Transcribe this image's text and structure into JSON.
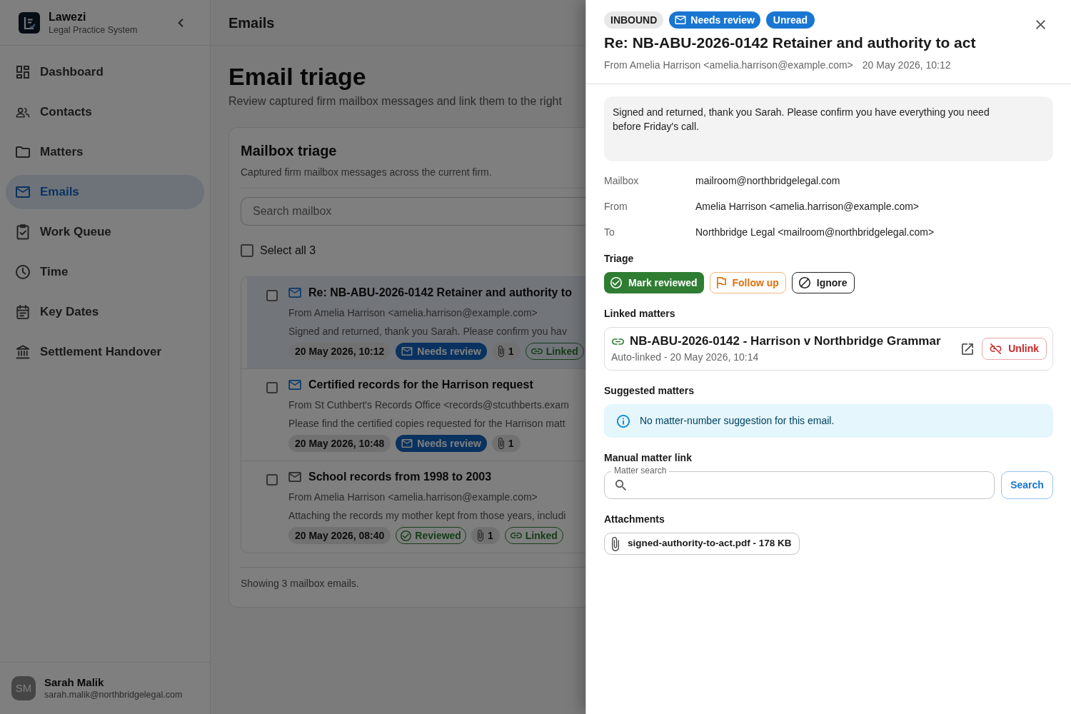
{
  "app": {
    "name": "Lawezi",
    "tagline": "Legal Practice System"
  },
  "sidebar": {
    "items": [
      {
        "label": "Dashboard",
        "selected": false
      },
      {
        "label": "Contacts",
        "selected": false
      },
      {
        "label": "Matters",
        "selected": false
      },
      {
        "label": "Emails",
        "selected": true
      },
      {
        "label": "Work Queue",
        "selected": false
      },
      {
        "label": "Time",
        "selected": false
      },
      {
        "label": "Key Dates",
        "selected": false
      },
      {
        "label": "Settlement Handover",
        "selected": false
      }
    ]
  },
  "user": {
    "initials": "SM",
    "name": "Sarah Malik",
    "email": "sarah.malik@northbridgelegal.com"
  },
  "header": {
    "title": "Emails"
  },
  "page": {
    "title": "Email triage",
    "subtitle": "Review captured firm mailbox messages and link them to the right"
  },
  "mailbox": {
    "title": "Mailbox triage",
    "subtitle": "Captured firm mailbox messages across the current firm.",
    "search": {
      "placeholder": "Search mailbox"
    },
    "select_all": {
      "label": "Select all 3",
      "checked": false
    },
    "emails": [
      {
        "subject": "Re: NB-ABU-2026-0142 Retainer and authority to",
        "from": "From Amelia Harrison <amelia.harrison@example.com>",
        "preview": "Signed and returned, thank you Sarah. Please confirm you hav",
        "date": "20 May 2026, 10:12",
        "status": {
          "kind": "needs_review",
          "label": "Needs review"
        },
        "attachments": "1",
        "link_label": "Linked",
        "unread": true,
        "selected": true,
        "checked": false
      },
      {
        "subject": "Certified records for the Harrison request",
        "from": "From St Cuthbert's Records Office <records@stcuthberts.exam",
        "preview": "Please find the certified copies requested for the Harrison matt",
        "date": "20 May 2026, 10:48",
        "status": {
          "kind": "needs_review",
          "label": "Needs review"
        },
        "attachments": "1",
        "unread": true,
        "selected": false,
        "checked": false
      },
      {
        "subject": "School records from 1998 to 2003",
        "from": "From Amelia Harrison <amelia.harrison@example.com>",
        "preview": "Attaching the records my mother kept from those years, includi",
        "date": "20 May 2026, 08:40",
        "status": {
          "kind": "reviewed",
          "label": "Reviewed"
        },
        "attachments": "1",
        "link_label": "Linked",
        "unread": false,
        "selected": false,
        "checked": false
      }
    ],
    "footer": "Showing 3 mailbox emails."
  },
  "drawer": {
    "badges": [
      {
        "kind": "neutral",
        "label": "INBOUND"
      },
      {
        "kind": "needs_review",
        "label": "Needs review"
      },
      {
        "kind": "info",
        "label": "Unread"
      }
    ],
    "subject": "Re: NB-ABU-2026-0142 Retainer and authority to act",
    "from": "From Amelia Harrison <amelia.harrison@example.com>",
    "date": "20 May 2026, 10:12",
    "body": "Signed and returned, thank you Sarah. Please confirm you have everything you need before Friday's call.",
    "details": [
      {
        "label": "Mailbox",
        "value": "mailroom@northbridgelegal.com"
      },
      {
        "label": "From",
        "value": "Amelia Harrison <amelia.harrison@example.com>"
      },
      {
        "label": "To",
        "value": "Northbridge Legal <mailroom@northbridgelegal.com>"
      }
    ],
    "triage": {
      "title": "Triage",
      "actions": [
        {
          "kind": "success",
          "label": "Mark reviewed"
        },
        {
          "kind": "warning",
          "label": "Follow up"
        },
        {
          "kind": "neutral",
          "label": "Ignore"
        }
      ]
    },
    "linked_matters": {
      "title": "Linked matters",
      "items": [
        {
          "title": "NB-ABU-2026-0142 - Harrison v Northbridge Grammar",
          "meta": "Auto-linked - 20 May 2026, 10:14",
          "action": "Unlink"
        }
      ]
    },
    "suggested_matters": {
      "title": "Suggested matters",
      "message": "No matter-number suggestion for this email."
    },
    "manual_link": {
      "title": "Manual matter link",
      "field_label": "Matter search",
      "button": "Search"
    },
    "attachments": {
      "title": "Attachments",
      "files": [
        {
          "label": "signed-authority-to-act.pdf - 178 KB"
        }
      ]
    }
  }
}
